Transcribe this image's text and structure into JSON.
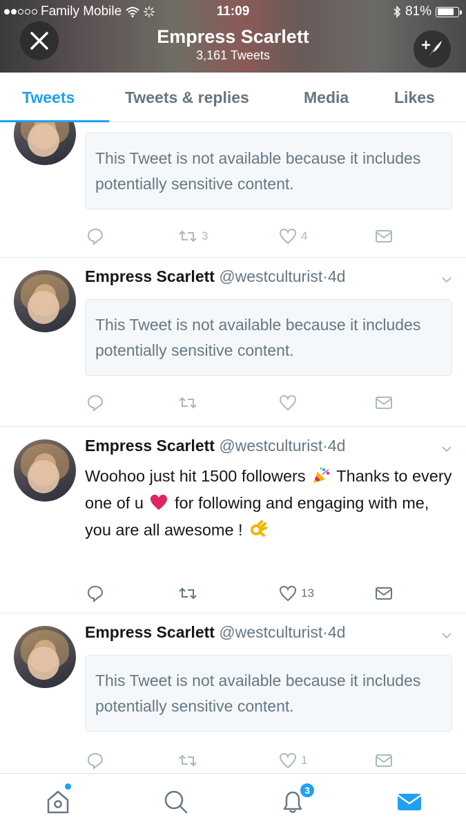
{
  "status_bar": {
    "carrier": "Family Mobile",
    "time": "11:09",
    "battery": "81%",
    "battery_level": 0.81
  },
  "profile": {
    "name": "Empress Scarlett",
    "tweet_count": "3,161 Tweets"
  },
  "tabs": [
    {
      "label": "Tweets",
      "active": true
    },
    {
      "label": "Tweets & replies",
      "active": false
    },
    {
      "label": "Media",
      "active": false
    },
    {
      "label": "Likes",
      "active": false
    }
  ],
  "withheld_notice": "This Tweet is not available because it includes potentially sensitive content.",
  "tweets": [
    {
      "name": "",
      "handle": "",
      "separator": "",
      "time": "",
      "withheld": true,
      "notice": "This Tweet is not available because it includes potentially sensitive content.",
      "retweets": "3",
      "likes": "4"
    },
    {
      "name": "Empress Scarlett",
      "handle": "@westculturist",
      "separator": "·",
      "time": "4d",
      "withheld": true,
      "notice": "This Tweet is not available because it includes potentially sensitive content.",
      "retweets": "",
      "likes": ""
    },
    {
      "name": "Empress Scarlett",
      "handle": "@westculturist",
      "separator": "·",
      "time": "4d",
      "withheld": false,
      "text_part1": "Woohoo just hit 1500 followers",
      "text_part2": "Thanks to every one of u",
      "text_part3": "for following and engaging with me, you are all awesome !",
      "emoji": [
        "party-popper-icon",
        "red-heart-icon",
        "ok-hand-icon"
      ],
      "retweets": "",
      "likes": "13"
    },
    {
      "name": "Empress Scarlett",
      "handle": "@westculturist",
      "separator": "·",
      "time": "4d",
      "withheld": true,
      "notice": "This Tweet is not available because it includes potentially sensitive content.",
      "retweets": "",
      "likes": "1"
    }
  ],
  "bottom_nav": {
    "items": [
      "home-icon",
      "search-icon",
      "notifications-icon",
      "messages-icon"
    ],
    "notification_badge": "3"
  },
  "colors": {
    "accent": "#1da1f2",
    "text_primary": "#14171a",
    "text_secondary": "#657786",
    "icon_muted": "#aab8c2",
    "heart": "#e0245e"
  }
}
